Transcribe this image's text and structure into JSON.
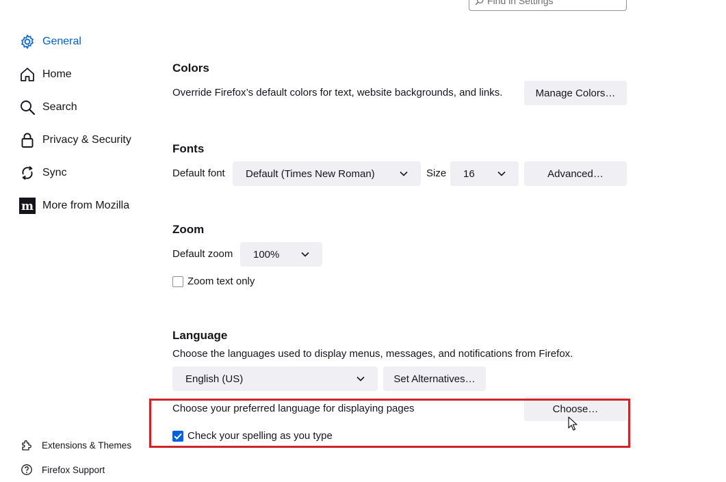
{
  "search": {
    "placeholder": "Find in Settings"
  },
  "sidebar": {
    "items": [
      {
        "label": "General",
        "icon": "gear-icon",
        "selected": true
      },
      {
        "label": "Home",
        "icon": "home-icon"
      },
      {
        "label": "Search",
        "icon": "search-icon"
      },
      {
        "label": "Privacy & Security",
        "icon": "lock-icon"
      },
      {
        "label": "Sync",
        "icon": "sync-icon"
      },
      {
        "label": "More from Mozilla",
        "icon": "mozilla-icon"
      }
    ],
    "footer": [
      {
        "label": "Extensions & Themes",
        "icon": "puzzle-icon"
      },
      {
        "label": "Firefox Support",
        "icon": "help-icon"
      }
    ]
  },
  "colors": {
    "heading": "Colors",
    "description": "Override Firefox’s default colors for text, website backgrounds, and links.",
    "manage_button": "Manage Colors…"
  },
  "fonts": {
    "heading": "Fonts",
    "default_font_label": "Default font",
    "default_font_value": "Default (Times New Roman)",
    "size_label": "Size",
    "size_value": "16",
    "advanced_button": "Advanced…"
  },
  "zoom": {
    "heading": "Zoom",
    "default_zoom_label": "Default zoom",
    "default_zoom_value": "100%",
    "zoom_text_only_label": "Zoom text only",
    "zoom_text_only_checked": false
  },
  "language": {
    "heading": "Language",
    "description": "Choose the languages used to display menus, messages, and notifications from Firefox.",
    "language_value": "English (US)",
    "set_alternatives_button": "Set Alternatives…",
    "preferred_language_text": "Choose your preferred language for displaying pages",
    "choose_button": "Choose…",
    "spellcheck_label": "Check your spelling as you type",
    "spellcheck_checked": true
  },
  "theme": {
    "accent": "#0061e0",
    "highlight": "#d0232a",
    "button_bg": "#f0f0f4"
  }
}
